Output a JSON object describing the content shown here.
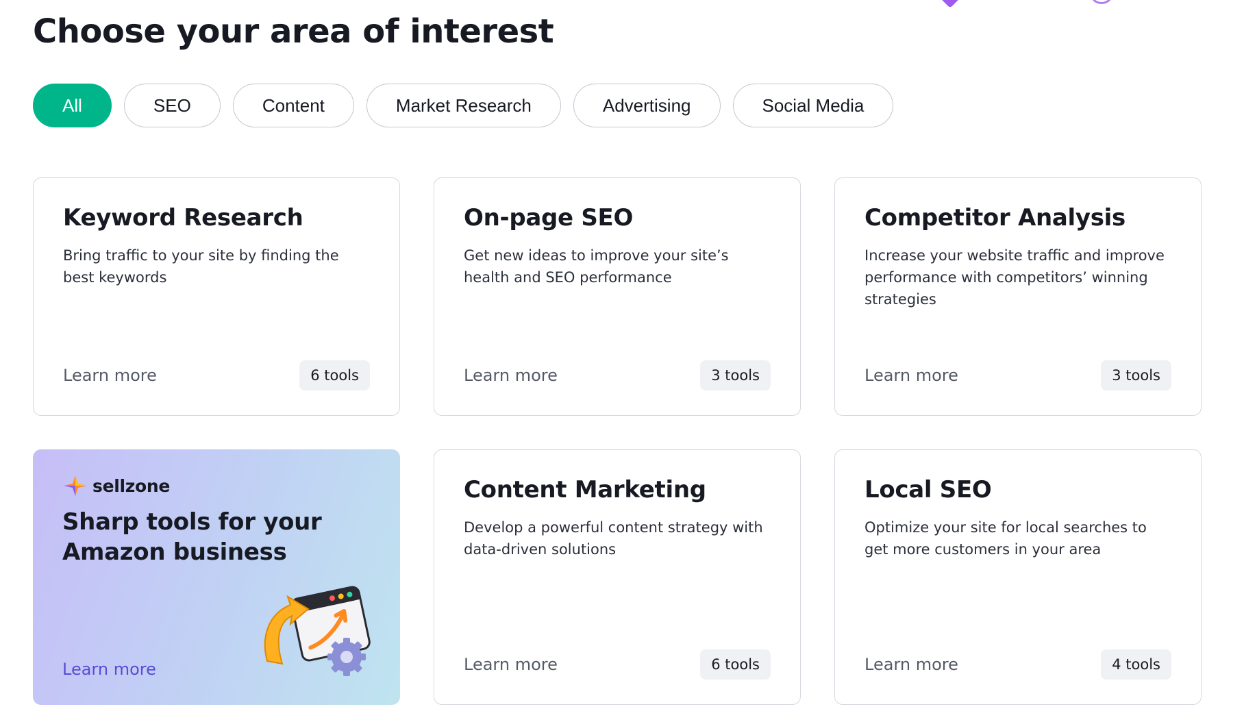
{
  "page": {
    "title": "Choose your area of interest"
  },
  "filters": [
    {
      "label": "All",
      "active": true
    },
    {
      "label": "SEO",
      "active": false
    },
    {
      "label": "Content",
      "active": false
    },
    {
      "label": "Market Research",
      "active": false
    },
    {
      "label": "Advertising",
      "active": false
    },
    {
      "label": "Social Media",
      "active": false
    }
  ],
  "cards": [
    {
      "title": "Keyword Research",
      "description": "Bring traffic to your site by finding the best keywords",
      "link": "Learn more",
      "tools": "6 tools"
    },
    {
      "title": "On-page SEO",
      "description": "Get new ideas to improve your site’s health and SEO performance",
      "link": "Learn more",
      "tools": "3 tools"
    },
    {
      "title": "Competitor Analysis",
      "description": "Increase your website traffic and improve performance with competitors’ winning strategies",
      "link": "Learn more",
      "tools": "3 tools"
    },
    {
      "title": "Content Marketing",
      "description": "Develop a powerful content strategy with data-driven solutions",
      "link": "Learn more",
      "tools": "6 tools"
    },
    {
      "title": "Local SEO",
      "description": "Optimize your site for local searches to get more customers in your area",
      "link": "Learn more",
      "tools": "4 tools"
    }
  ],
  "promo": {
    "brand": "sellzone",
    "title": "Sharp tools for your Amazon business",
    "link": "Learn more",
    "illustration_icon": "browser-arrow-gear-illustration",
    "brand_icon": "sellzone-star-logo"
  },
  "colors": {
    "accent_green": "#00b589",
    "promo_link": "#5b4bd6",
    "card_border": "#d6d8de",
    "badge_bg": "#f0f1f4",
    "deco_purple": "#a05af0"
  }
}
